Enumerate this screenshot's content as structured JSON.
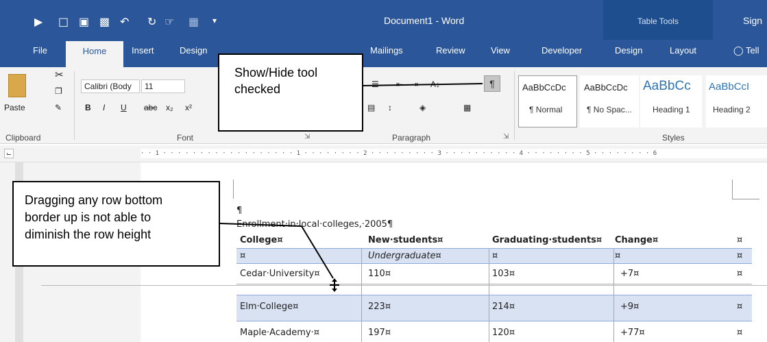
{
  "window": {
    "title": "Document1  -  Word",
    "table_tools": "Table Tools",
    "sign_in": "Sign"
  },
  "quick_access": {
    "icons": [
      "folder-open-icon",
      "new-document-icon",
      "save-icon",
      "save-as-icon",
      "undo-icon",
      "redo-icon",
      "touch-mode-icon",
      "table-icon",
      "customize-icon"
    ]
  },
  "tabs": [
    "File",
    "Home",
    "Insert",
    "Design",
    "Mailings",
    "Review",
    "View",
    "Developer",
    "Design",
    "Layout",
    "Tell"
  ],
  "ribbon": {
    "clipboard": {
      "paste": "Paste",
      "label": "Clipboard"
    },
    "font": {
      "name": "Calibri (Body",
      "size": "11",
      "bold": "B",
      "italic": "I",
      "underline": "U",
      "strike": "abc",
      "subscript": "x₂",
      "superscript": "x²",
      "label": "Font"
    },
    "paragraph": {
      "label": "Paragraph",
      "show_hide": "¶",
      "sort": "A↓"
    },
    "styles": {
      "label": "Styles",
      "items": [
        {
          "sample": "AaBbCcDc",
          "name": "¶ Normal"
        },
        {
          "sample": "AaBbCcDc",
          "name": "¶ No Spac..."
        },
        {
          "sample": "AaBbCc",
          "name": "Heading 1"
        },
        {
          "sample": "AaBbCcI",
          "name": "Heading 2"
        }
      ]
    }
  },
  "ruler": {
    "text": "· · 1 · · · · · · · · · · · · · · · · · · 1 · · · · · · · · 2 · · · · · · · · · 3 · · · · · · · · · · 4 · · · · · · · · 5 · · · · · · · · 6"
  },
  "document": {
    "pilcrow": "¶",
    "caption": "Enrollment·in·local·colleges,·2005¶",
    "headers": [
      "College¤",
      "New·students¤",
      "Graduating·students¤",
      "Change¤",
      "¤"
    ],
    "rows": [
      [
        "¤",
        "Undergraduate¤",
        "¤",
        "¤",
        "¤"
      ],
      [
        "Cedar·University¤",
        "110¤",
        "103¤",
        "+7¤",
        "¤"
      ],
      [
        "Elm·College¤",
        "223¤",
        "214¤",
        "+9¤",
        "¤"
      ],
      [
        "Maple·Academy·¤",
        "197¤",
        "120¤",
        "+77¤",
        "¤"
      ]
    ]
  },
  "callouts": {
    "show_hide": [
      "Show/Hide tool",
      "checked"
    ],
    "row_height": [
      "Dragging any row bottom",
      "border up is not  able to",
      "diminish the row height"
    ]
  },
  "colors": {
    "accent": "#2b579a",
    "table_tools": "#1f4e8f",
    "table_shade": "#d9e2f3"
  }
}
